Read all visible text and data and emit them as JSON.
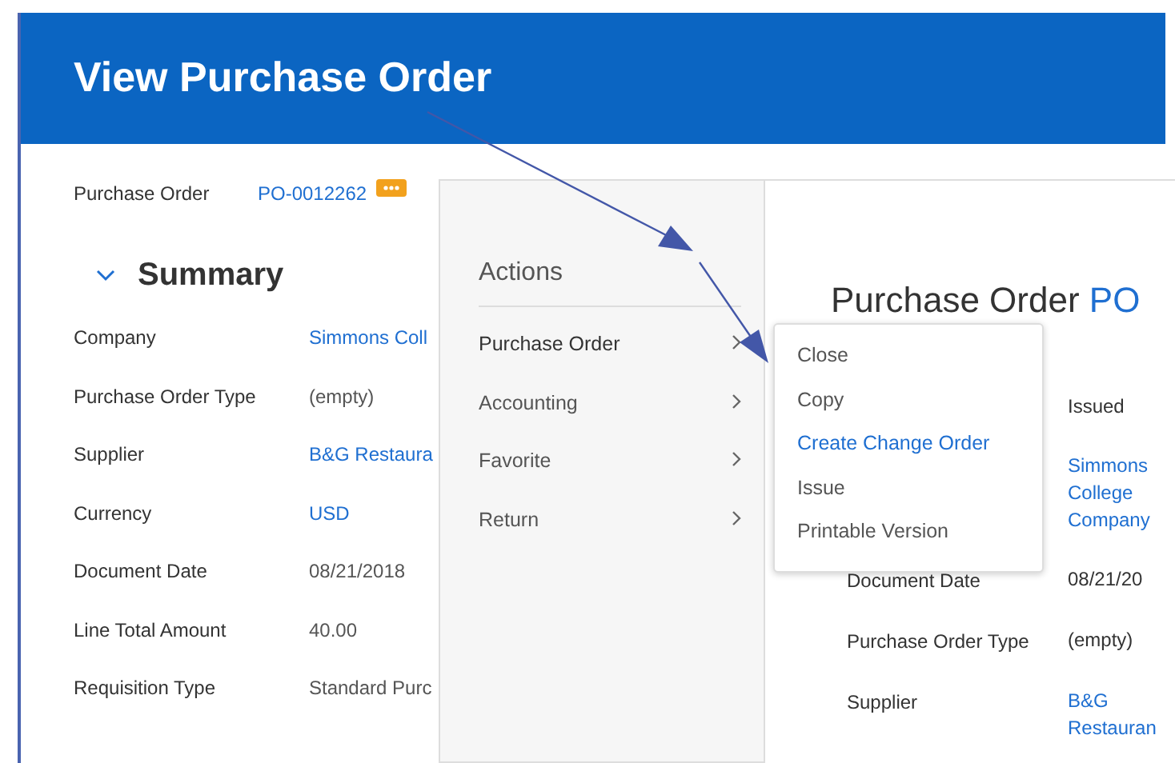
{
  "header": {
    "title": "View Purchase Order"
  },
  "record": {
    "label": "Purchase Order",
    "value": "PO-0012262"
  },
  "summary": {
    "heading": "Summary",
    "expanded": true,
    "fields": [
      {
        "label": "Company",
        "value": "Simmons Coll",
        "link": true
      },
      {
        "label": "Purchase Order Type",
        "value": "(empty)",
        "link": false
      },
      {
        "label": "Supplier",
        "value": "B&G Restaura",
        "link": true
      },
      {
        "label": "Currency",
        "value": "USD",
        "link": true
      },
      {
        "label": "Document Date",
        "value": "08/21/2018",
        "link": false
      },
      {
        "label": "Line Total Amount",
        "value": "40.00",
        "link": false
      },
      {
        "label": "Requisition Type",
        "value": "Standard Purc",
        "link": false
      }
    ]
  },
  "actions": {
    "heading": "Actions",
    "items": [
      {
        "label": "Purchase Order",
        "selected": true
      },
      {
        "label": "Accounting",
        "selected": false
      },
      {
        "label": "Favorite",
        "selected": false
      },
      {
        "label": "Return",
        "selected": false
      }
    ]
  },
  "submenu": {
    "items": [
      {
        "label": "Close",
        "link": false
      },
      {
        "label": "Copy",
        "link": false
      },
      {
        "label": "Create Change Order",
        "link": true
      },
      {
        "label": "Issue",
        "link": false
      },
      {
        "label": "Printable Version",
        "link": false
      }
    ]
  },
  "preview": {
    "title": "Purchase Order",
    "title_ref": "PO",
    "fields": [
      {
        "value": [
          "Issued"
        ],
        "link": false
      },
      {
        "value": [
          "Simmons",
          "College",
          "Company"
        ],
        "link": true
      },
      {
        "label": "Document Date",
        "value": [
          "08/21/20"
        ],
        "link": false
      },
      {
        "label": "Purchase Order Type",
        "value": [
          "(empty)"
        ],
        "link": false
      },
      {
        "label": "Supplier",
        "value": [
          "B&G",
          "Restauran"
        ],
        "link": true
      }
    ]
  }
}
